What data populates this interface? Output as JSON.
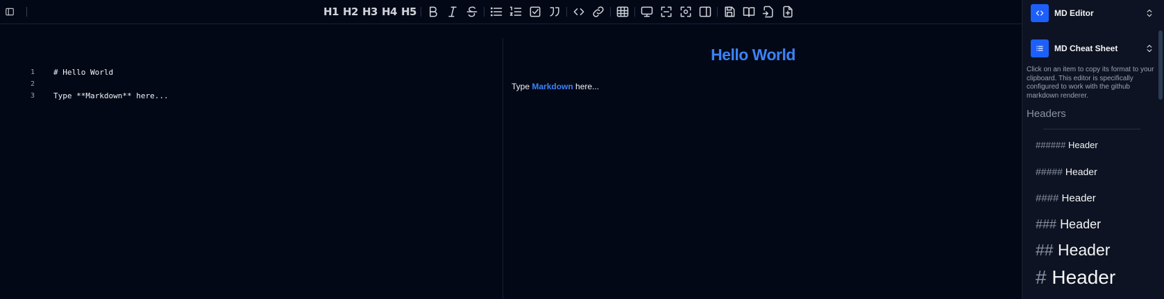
{
  "toolbar": {
    "headings": [
      "H1",
      "H2",
      "H3",
      "H4",
      "H5"
    ]
  },
  "editor": {
    "lines": [
      {
        "number": "1",
        "text": "# Hello World"
      },
      {
        "number": "2",
        "text": ""
      },
      {
        "number": "3",
        "text": "Type **Markdown** here..."
      }
    ]
  },
  "preview": {
    "title": "Hello World",
    "para_before": "Type ",
    "para_bold": "Markdown",
    "para_after": " here..."
  },
  "sidebar": {
    "app_switcher": {
      "label": "MD Editor",
      "icon": "code-icon"
    },
    "tool_switcher": {
      "label": "MD Cheat Sheet",
      "icon": "list-icon"
    },
    "description": "Click on an item to copy its format to your clipboard. This editor is specifically configured to work with the github markdown renderer.",
    "section_heading": "Headers",
    "header_items": [
      {
        "hash": "######",
        "label": "Header"
      },
      {
        "hash": "#####",
        "label": "Header"
      },
      {
        "hash": "####",
        "label": "Header"
      },
      {
        "hash": "###",
        "label": "Header"
      },
      {
        "hash": "##",
        "label": "Header"
      },
      {
        "hash": "#",
        "label": "Header"
      }
    ]
  },
  "colors": {
    "background": "#030817",
    "sidebar": "#0d1322",
    "accent": "#3b82f6",
    "switcher_icon": "#1d5ffb"
  }
}
